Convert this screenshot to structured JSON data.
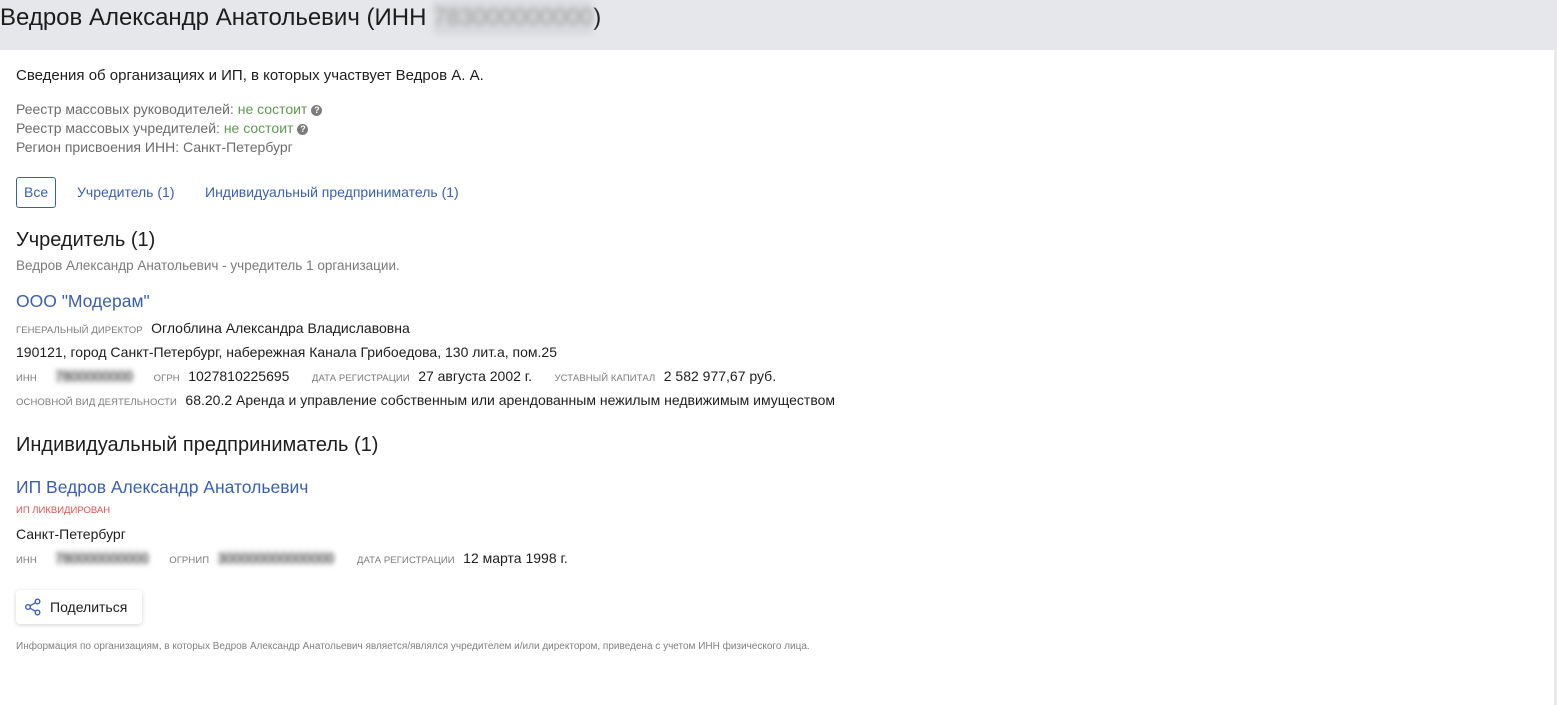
{
  "header": {
    "title_prefix": "Ведров Александр Анатольевич (ИНН ",
    "inn_blurred": "783000000000",
    "title_suffix": ")"
  },
  "summary": {
    "subtitle": "Сведения об организациях и ИП, в которых участвует Ведров А. А.",
    "mass_directors_label": "Реестр массовых руководителей:",
    "mass_directors_value": "не состоит",
    "mass_founders_label": "Реестр массовых учредителей:",
    "mass_founders_value": "не состоит",
    "region_label": "Регион присвоения ИНН:",
    "region_value": "Санкт-Петербург",
    "help_icon_glyph": "?"
  },
  "tabs": [
    {
      "label": "Все",
      "active": true
    },
    {
      "label": "Учредитель (1)",
      "active": false
    },
    {
      "label": "Индивидуальный предприниматель (1)",
      "active": false
    }
  ],
  "founder_section": {
    "title": "Учредитель (1)",
    "description": "Ведров Александр Анатольевич - учредитель 1 организации.",
    "org": {
      "name": "ООО \"Модерам\"",
      "director_label": "генеральный директор",
      "director_value": "Оглоблина Александра Владиславовна",
      "address": "190121, город Санкт-Петербург, набережная Канала Грибоедова, 130 лит.а, пом.25",
      "inn_label": "ИНН",
      "inn_blurred": "7800000000",
      "ogrn_label": "ОГРН",
      "ogrn_value": "1027810225695",
      "reg_date_label": "дата регистрации",
      "reg_date_value": "27 августа 2002 г.",
      "capital_label": "уставный капитал",
      "capital_value": "2 582 977,67 руб.",
      "activity_label": "основной вид деятельности",
      "activity_value": "68.20.2 Аренда и управление собственным или арендованным нежилым недвижимым имуществом"
    }
  },
  "ip_section": {
    "title": "Индивидуальный предприниматель (1)",
    "ip": {
      "name": "ИП Ведров Александр Анатольевич",
      "status": "ИП ликвидирован",
      "city": "Санкт-Петербург",
      "inn_label": "ИНН",
      "inn_blurred": "780000000000",
      "ogrnip_label": "ОГРНИП",
      "ogrnip_blurred": "300000000000000",
      "reg_date_label": "дата регистрации",
      "reg_date_value": "12 марта 1998 г."
    }
  },
  "share_button": {
    "label": "Поделиться",
    "icon": "share-icon"
  },
  "footnote": "Информация по организациям, в которых Ведров Александр Анатольевич является/являлся учредителем и/или директором, приведена с учетом ИНН физического лица.",
  "colors": {
    "header_bg": "#e5e7ea",
    "link": "#3a5fb0",
    "positive": "#5b9a50",
    "danger": "#e05050"
  }
}
